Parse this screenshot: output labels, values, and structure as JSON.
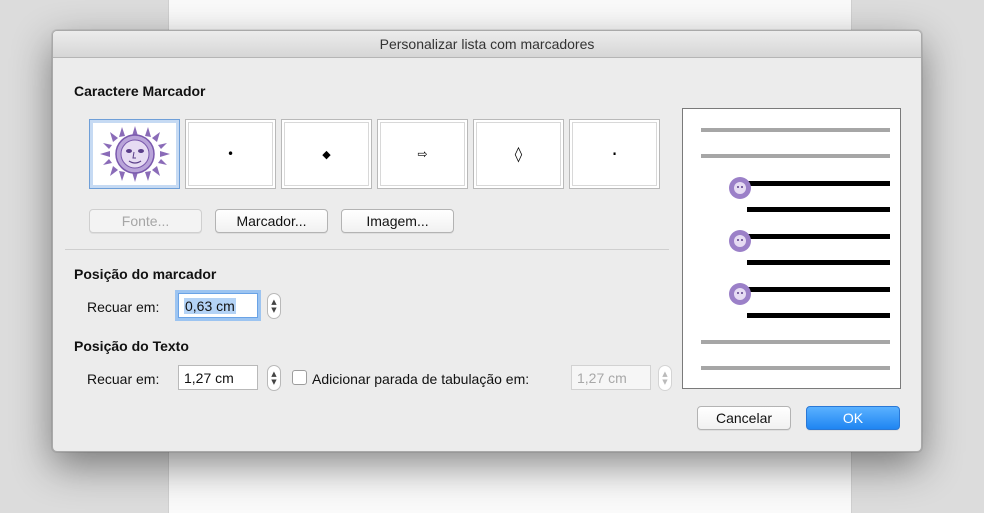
{
  "window": {
    "title": "Personalizar lista com marcadores"
  },
  "bullet_character": {
    "section_title": "Caractere Marcador",
    "glyphs": [
      {
        "icon": "sun-face-icon",
        "symbol": ""
      },
      {
        "icon": "dot-bullet-icon",
        "symbol": "•"
      },
      {
        "icon": "diamond-bullet-icon",
        "symbol": "◆"
      },
      {
        "icon": "arrow-bullet-icon",
        "symbol": "⇨"
      },
      {
        "icon": "hollow-diamond-bullet-icon",
        "symbol": "◊"
      },
      {
        "icon": "small-dot-bullet-icon",
        "symbol": "·"
      }
    ],
    "buttons": {
      "font": "Fonte...",
      "bullet": "Marcador...",
      "image": "Imagem..."
    }
  },
  "bullet_position": {
    "section_title": "Posição do marcador",
    "indent_label": "Recuar em:",
    "indent_value": "0,63 cm"
  },
  "text_position": {
    "section_title": "Posição do Texto",
    "indent_label": "Recuar em:",
    "indent_value": "1,27 cm",
    "tab_stop_label": "Adicionar parada de tabulação em:",
    "tab_stop_value": "1,27 cm",
    "tab_stop_checked": false
  },
  "actions": {
    "cancel": "Cancelar",
    "ok": "OK"
  },
  "colors": {
    "accent": "#1f85f2",
    "bullet_purple": "#8a6bb8"
  }
}
